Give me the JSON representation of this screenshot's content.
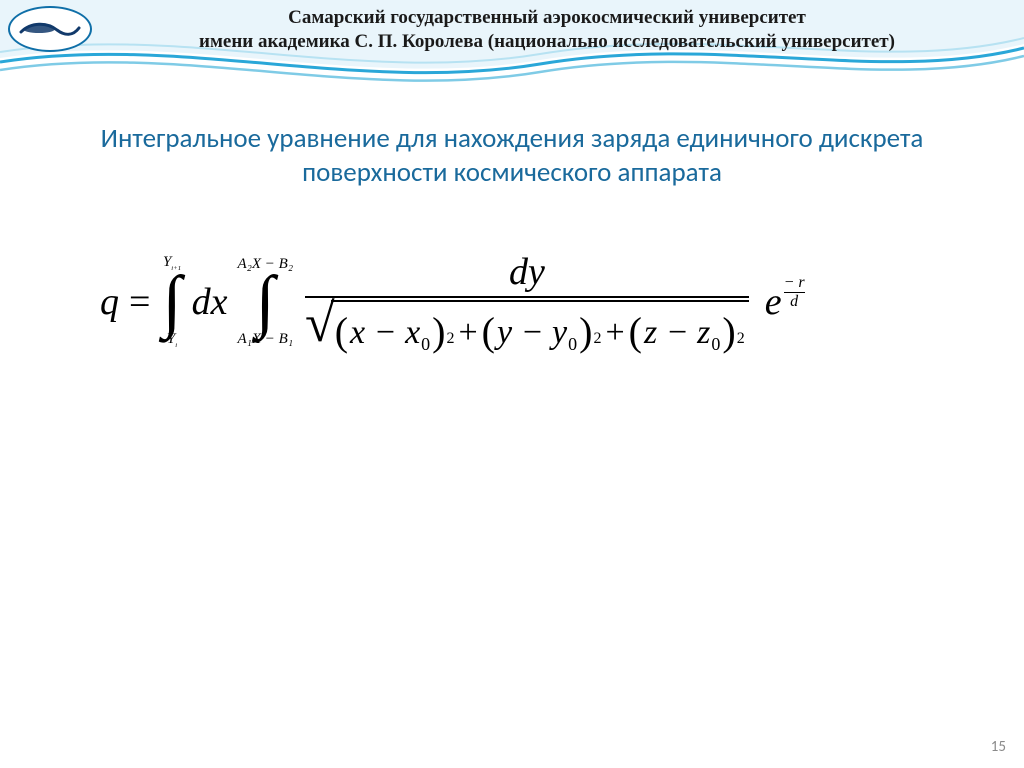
{
  "university": {
    "line1": "Самарский государственный аэрокосмический университет",
    "line2": "имени академика С. П. Королева (национально исследовательский университет)"
  },
  "title": "Интегральное уравнение для нахождения заряда единичного дискрета поверхности космического аппарата",
  "formula": {
    "lhs": "q",
    "equals": "=",
    "int1_upper": "Y",
    "int1_upper_sub": "i+1",
    "int1_lower": "Y",
    "int1_lower_sub": "i",
    "dx": "dx",
    "int2_upper": "A₂X − B₂",
    "int2_lower": "A₁X − B₁",
    "numerator": "dy",
    "den_terms": [
      {
        "v1": "x",
        "v2": "x",
        "sub": "0"
      },
      {
        "v1": "y",
        "v2": "y",
        "sub": "0"
      },
      {
        "v1": "z",
        "v2": "z",
        "sub": "0"
      }
    ],
    "power": "2",
    "plus": "+",
    "minus": "−",
    "e": "e",
    "exp_num": "− r",
    "exp_den": "d"
  },
  "page_number": "15"
}
